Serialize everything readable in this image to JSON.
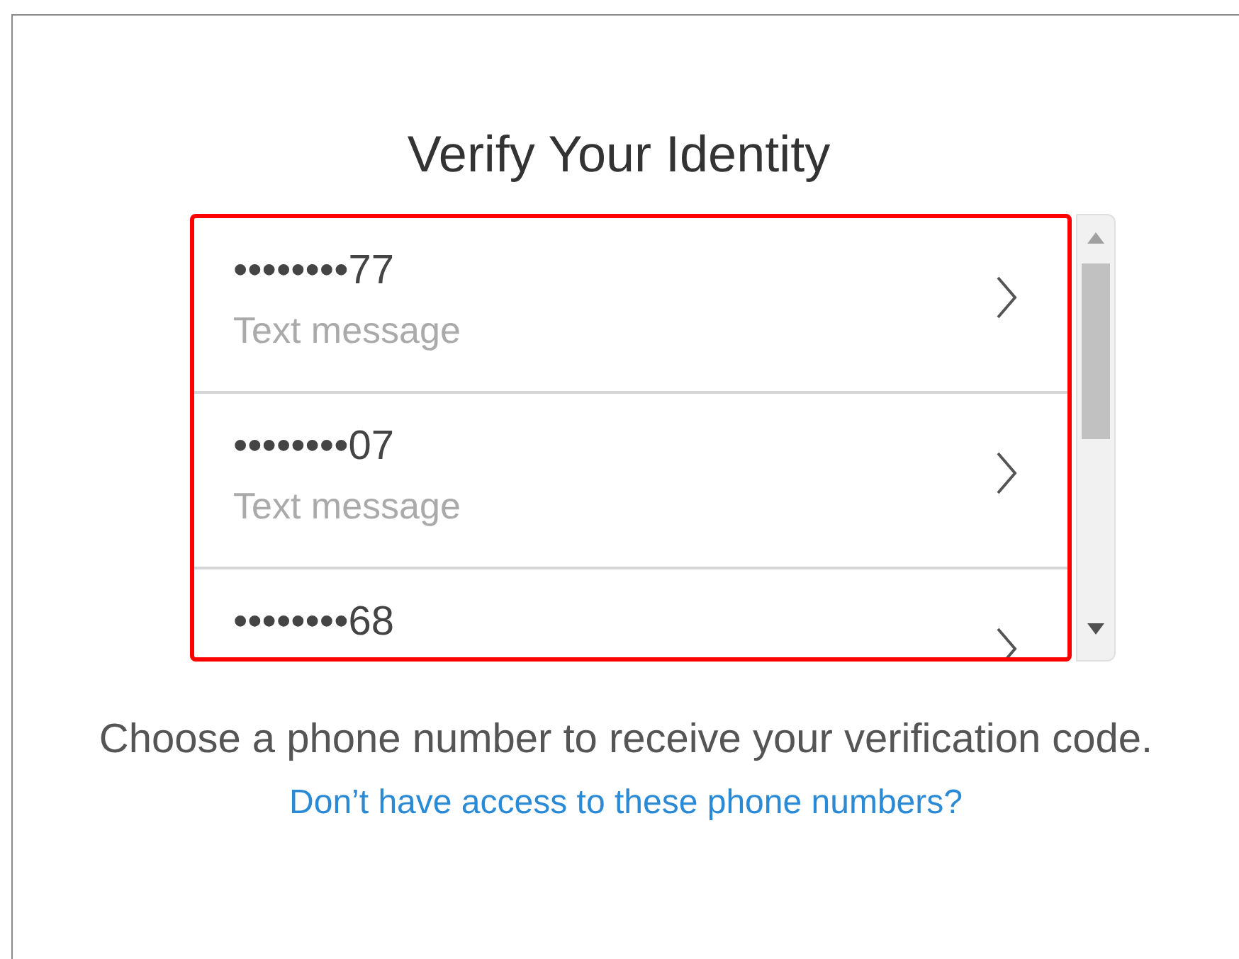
{
  "title": "Verify Your Identity",
  "phone_numbers": [
    {
      "number": "••••••••77",
      "method": "Text message"
    },
    {
      "number": "••••••••07",
      "method": "Text message"
    },
    {
      "number": "••••••••68"
    }
  ],
  "instruction": "Choose a phone number to receive your verification code.",
  "help_link": "Don’t have access to these phone numbers?"
}
